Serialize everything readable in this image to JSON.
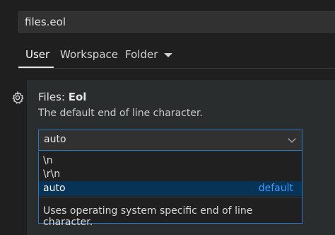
{
  "search": {
    "value": "files.eol"
  },
  "tabs": [
    {
      "label": "User",
      "active": true
    },
    {
      "label": "Workspace"
    },
    {
      "label": "Folder"
    }
  ],
  "setting": {
    "category": "Files: ",
    "name": "Eol",
    "description": "The default end of line character.",
    "selected_value": "auto",
    "options": [
      {
        "label": "\\n"
      },
      {
        "label": "\\r\\n"
      },
      {
        "label": "auto",
        "badge": "default",
        "highlighted": true
      }
    ],
    "option_description": "Uses operating system specific end of line character."
  },
  "colors": {
    "accent": "#2b78c2",
    "highlight": "#063356",
    "default_badge": "#3b9cff"
  },
  "icons": {
    "setting_gear": "gear-icon",
    "folder_caret": "chevron-down-icon",
    "select_chevron": "chevron-down-icon"
  }
}
